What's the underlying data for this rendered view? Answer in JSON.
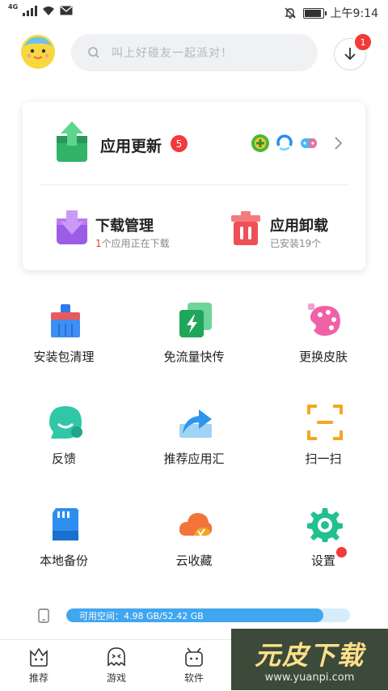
{
  "status_bar": {
    "network": "4G",
    "time": "上午9:14"
  },
  "header": {
    "search_placeholder": "叫上好碰友一起派对！",
    "download_badge": "1"
  },
  "update_card": {
    "app_update": {
      "label": "应用更新",
      "badge": "5"
    },
    "download_manager": {
      "title": "下载管理",
      "sub_count": "1",
      "sub_text": "个应用正在下载"
    },
    "uninstall": {
      "title": "应用卸载",
      "sub": "已安装19个"
    }
  },
  "tools": [
    {
      "label": "安装包清理",
      "icon": "broom-icon"
    },
    {
      "label": "免流量快传",
      "icon": "lightning-transfer-icon"
    },
    {
      "label": "更换皮肤",
      "icon": "palette-icon"
    },
    {
      "label": "反馈",
      "icon": "feedback-icon"
    },
    {
      "label": "推荐应用汇",
      "icon": "share-arrow-icon"
    },
    {
      "label": "扫一扫",
      "icon": "scan-icon"
    },
    {
      "label": "本地备份",
      "icon": "sd-card-icon"
    },
    {
      "label": "云收藏",
      "icon": "cloud-icon"
    },
    {
      "label": "设置",
      "icon": "gear-icon"
    }
  ],
  "storage": {
    "text": "可用空间：4.98 GB/52.42 GB",
    "used_fraction": 0.905
  },
  "bottom_nav": [
    {
      "label": "推荐",
      "icon": "recommend-icon"
    },
    {
      "label": "游戏",
      "icon": "game-icon"
    },
    {
      "label": "软件",
      "icon": "software-icon"
    }
  ],
  "watermark": {
    "title": "元皮下载",
    "url": "www.yuanpi.com"
  },
  "colors": {
    "accent": "#40a6f0",
    "badge": "#f23a3a"
  }
}
